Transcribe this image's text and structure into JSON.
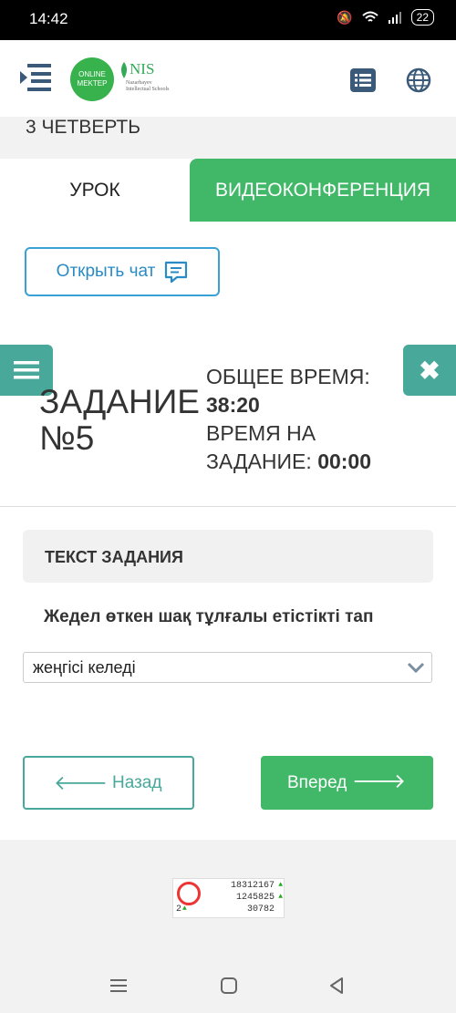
{
  "status_bar": {
    "time": "14:42",
    "battery": "22"
  },
  "header": {
    "logo_line1": "ONLINE",
    "logo_line2": "MEKTEP",
    "nis_title": "NIS",
    "nis_subtitle": "Nazarbayev Intellectual Schools"
  },
  "quarter": "3 ЧЕТВЕРТЬ",
  "tabs": {
    "lesson": "УРОК",
    "video": "ВИДЕОКОНФЕРЕНЦИЯ"
  },
  "chat_button": "Открыть чат",
  "task": {
    "title_line1": "ЗАДАНИЕ",
    "title_line2": "№5",
    "total_time_label": "ОБЩЕЕ ВРЕМЯ:",
    "total_time_value": "38:20",
    "task_time_label_1": "ВРЕМЯ НА",
    "task_time_label_2": "ЗАДАНИЕ:",
    "task_time_value": "00:00",
    "text_header": "ТЕКСТ ЗАДАНИЯ",
    "question": "Жедел өткен шақ тұлғалы етістікті тап",
    "selected_answer": "жеңгісі келеді"
  },
  "nav_buttons": {
    "back": "Назад",
    "next": "Вперед"
  },
  "counter": {
    "line1": "18312167",
    "line2": "1245825",
    "line3": "30782",
    "left": "2"
  },
  "colors": {
    "accent_green": "#41b868",
    "teal": "#48a89a",
    "blue": "#3aa1d6"
  }
}
